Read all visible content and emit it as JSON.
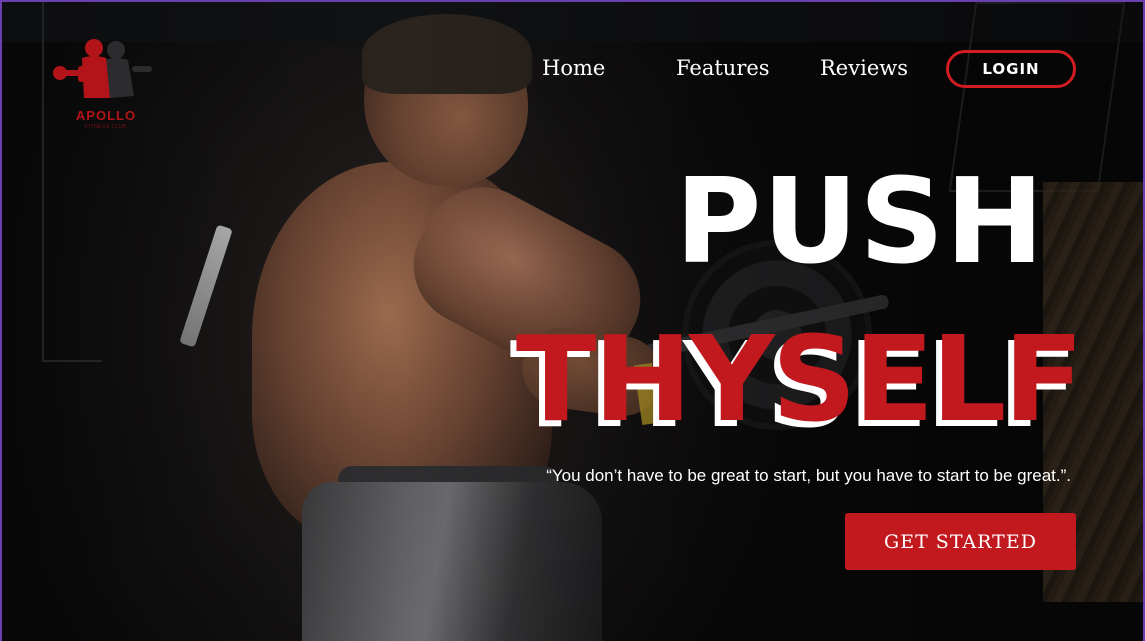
{
  "brand": {
    "logo_text": "APOLLO",
    "logo_tagline": "FITNESS CLUB",
    "accent_color": "#c2191f"
  },
  "nav": {
    "items": [
      {
        "label": "Home"
      },
      {
        "label": "Features"
      },
      {
        "label": "Reviews"
      }
    ],
    "login_label": "LOGIN"
  },
  "hero": {
    "headline_line1": "PUSH",
    "headline_line2": "THYSELF",
    "quote": "“You don’t have to be great to start, but you have to start to be great.”.",
    "cta_label": "GET STARTED"
  }
}
